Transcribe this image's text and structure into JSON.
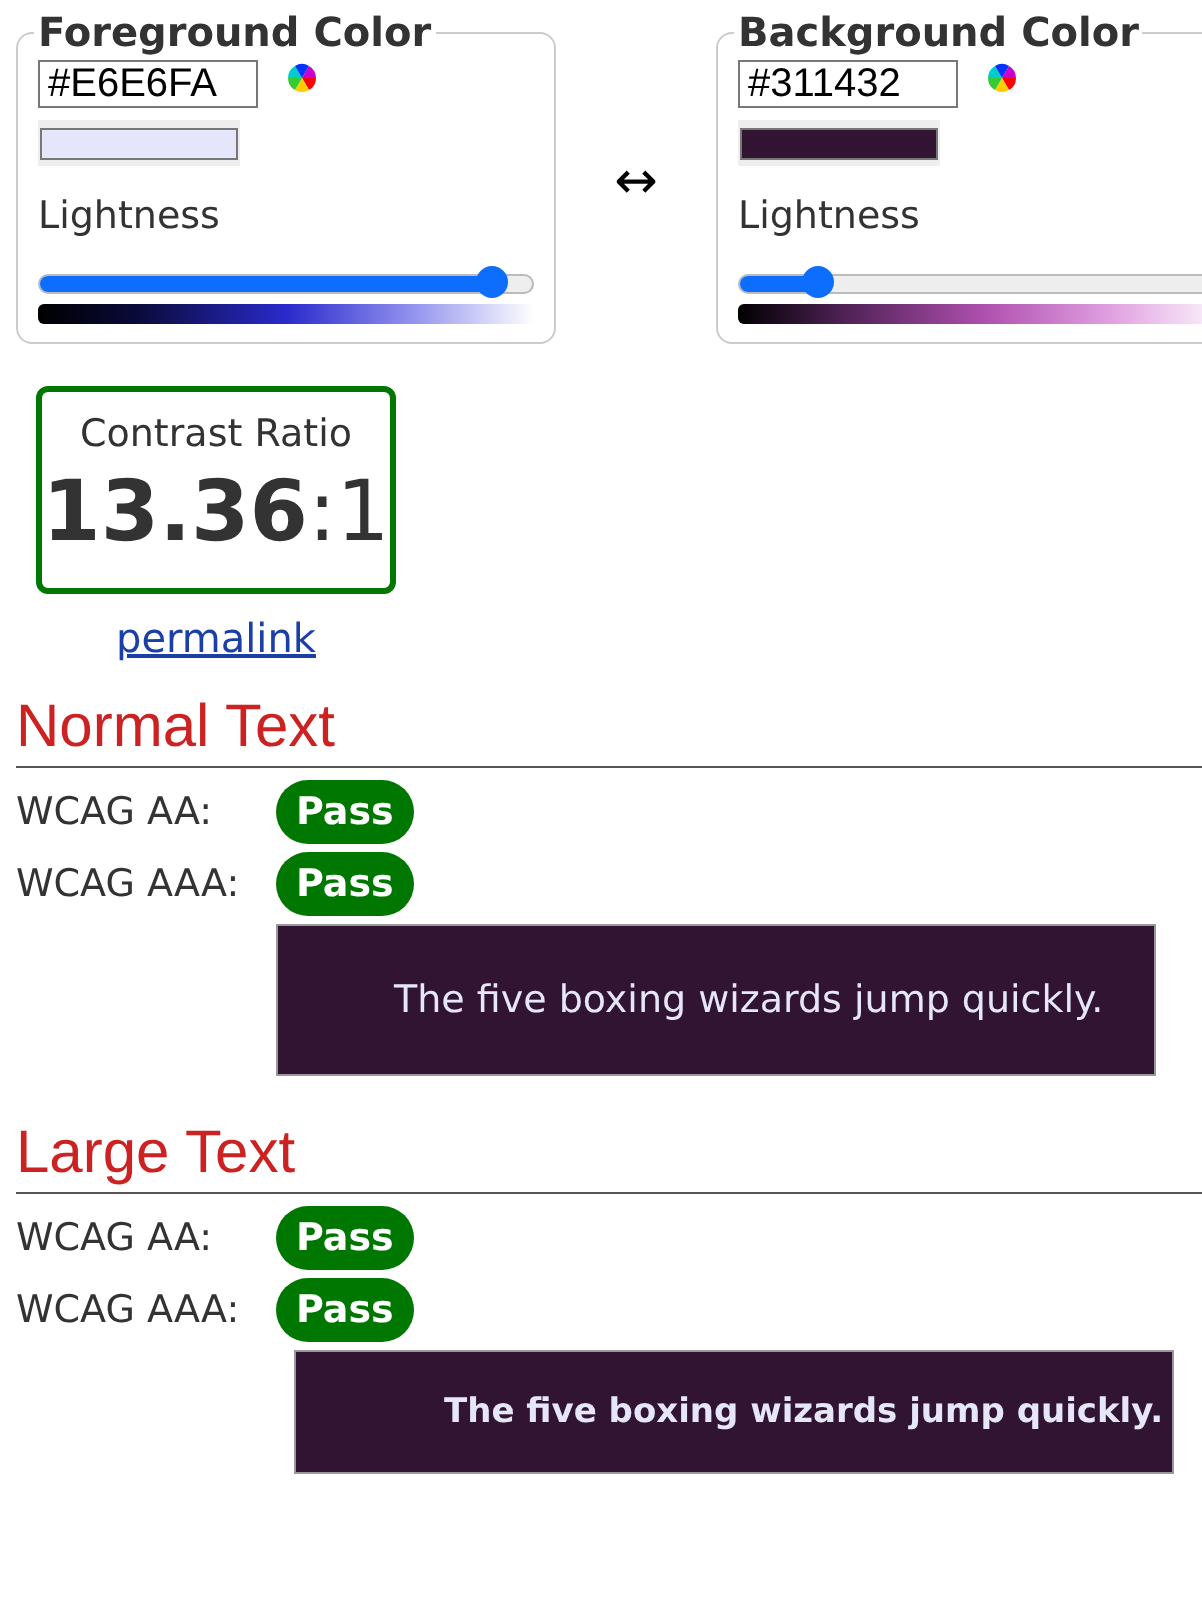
{
  "colors": [
    {
      "title": "Foreground Color",
      "value": "#E6E6FA",
      "color": "#e6e6fa",
      "slider_label": "Lightness",
      "level": 0.92,
      "kind": "foreground"
    },
    {
      "title": "Background Color",
      "value": "#311432",
      "color": "#311432",
      "slider_label": "Lightness",
      "level": 0.16,
      "kind": "background"
    }
  ],
  "swap": "↔",
  "contrast": {
    "label": "Contrast Ratio",
    "ratio": "**13.36**:1",
    "passed": true
  },
  "permalink": "permalink",
  "sections": [
    {
      "title": "Normal Text",
      "kind": "normal",
      "results": [
        {
          "label": "WCAG AA:",
          "result": "Pass",
          "passed": true
        },
        {
          "label": "WCAG AAA:",
          "result": "Pass",
          "passed": true
        }
      ],
      "sample": "The five boxing wizards jump quickly."
    },
    {
      "title": "Large Text",
      "kind": "large",
      "results": [
        {
          "label": "WCAG AA:",
          "result": "Pass",
          "passed": true
        },
        {
          "label": "WCAG AAA:",
          "result": "Pass",
          "passed": true
        }
      ],
      "sample": "The five boxing wizards jump quickly."
    }
  ]
}
